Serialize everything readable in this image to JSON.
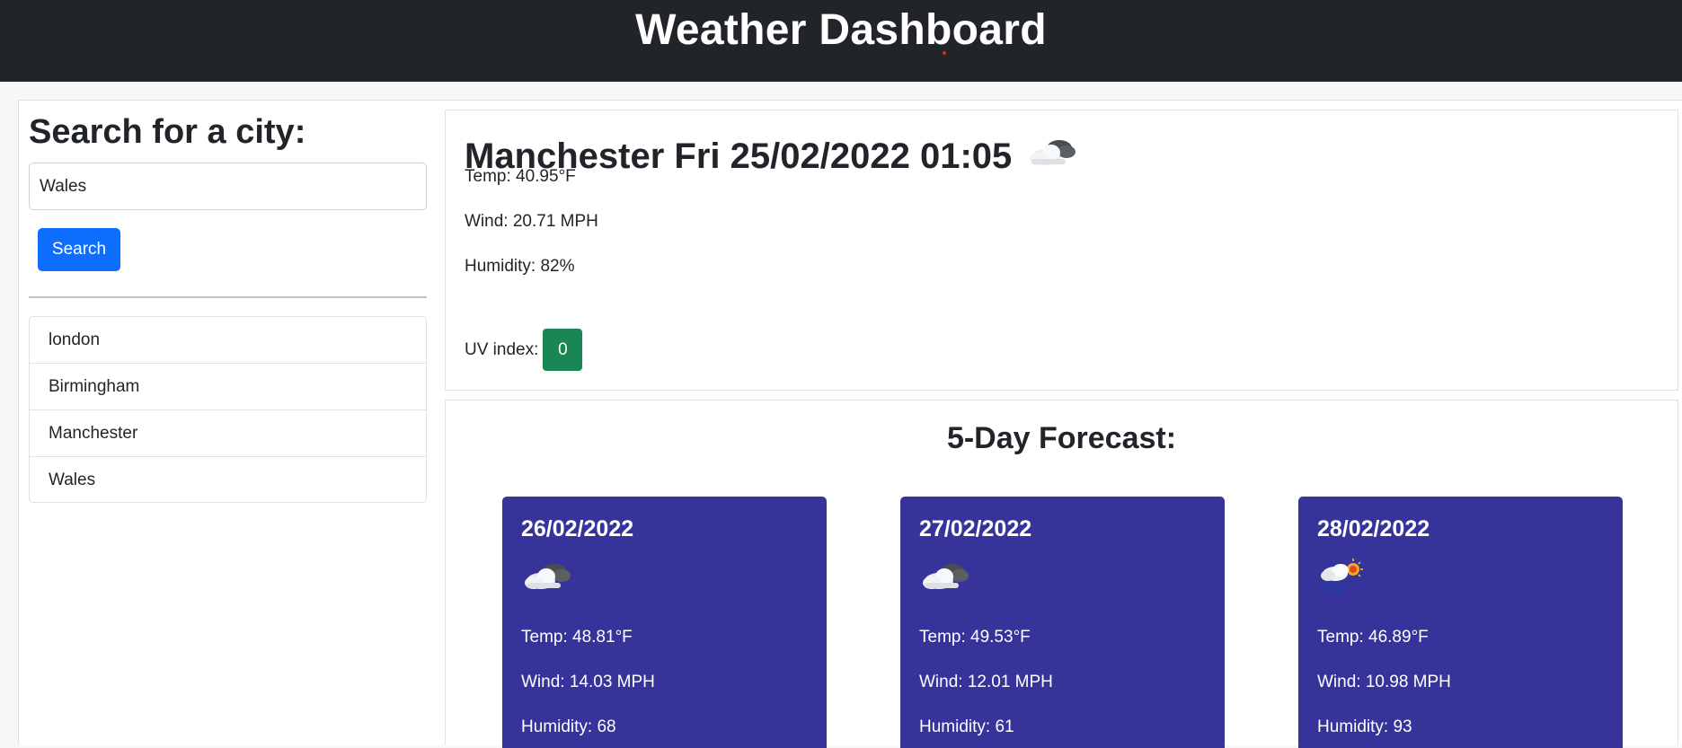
{
  "header": {
    "title": "Weather Dashboard"
  },
  "sidebar": {
    "heading": "Search for a city:",
    "search_value": "Wales",
    "search_button": "Search",
    "history": [
      "london",
      "Birmingham",
      "Manchester",
      "Wales"
    ]
  },
  "current": {
    "title": "Manchester Fri 25/02/2022 01:05",
    "icon": "cloud-icon",
    "temp": "Temp: 40.95°F",
    "wind": "Wind: 20.71 MPH",
    "humidity": "Humidity: 82%",
    "uv_label": "UV index:",
    "uv_value": "0",
    "uv_color": "#198754"
  },
  "forecast": {
    "heading": "5-Day Forecast:",
    "card_color": "#36349b",
    "days": [
      {
        "date": "26/02/2022",
        "icon": "cloud-icon",
        "temp": "Temp: 48.81°F",
        "wind": "Wind: 14.03 MPH",
        "humidity": "Humidity: 68"
      },
      {
        "date": "27/02/2022",
        "icon": "cloud-icon",
        "temp": "Temp: 49.53°F",
        "wind": "Wind: 12.01 MPH",
        "humidity": "Humidity: 61"
      },
      {
        "date": "28/02/2022",
        "icon": "rain-sun-icon",
        "temp": "Temp: 46.89°F",
        "wind": "Wind: 10.98 MPH",
        "humidity": "Humidity: 93"
      }
    ]
  }
}
